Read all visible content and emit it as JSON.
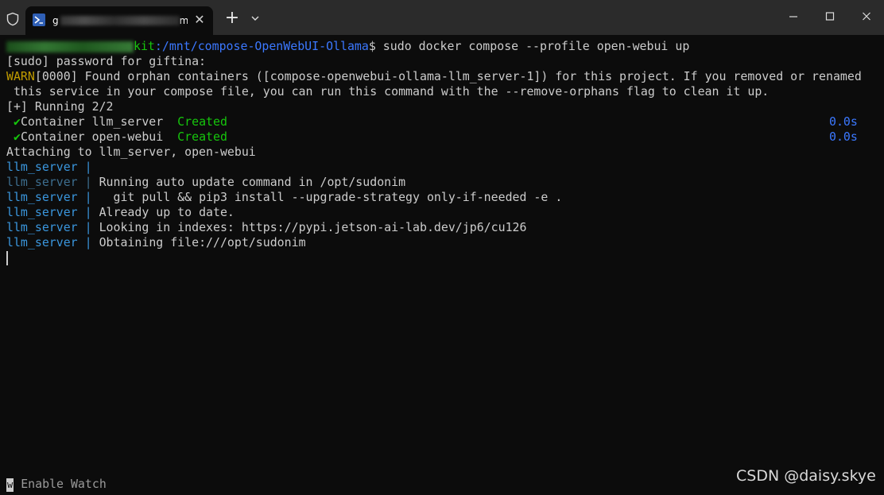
{
  "titlebar": {
    "tab_title": "g",
    "tab_title_tail": "m",
    "close_glyph": "✕",
    "new_tab_glyph": "+"
  },
  "prompt": {
    "user_visible_tail": "kit",
    "path": ":/mnt/compose-OpenWebUI-Ollama",
    "symbol": "$",
    "command": " sudo docker compose --profile open-webui up"
  },
  "lines": {
    "sudo": "[sudo] password for giftina:",
    "warn_label": "WARN",
    "warn_rest": "[0000] Found orphan containers ([compose-openwebui-ollama-llm_server-1]) for this project. If you removed or renamed",
    "warn_cont": " this service in your compose file, you can run this command with the --remove-orphans flag to clean it up.",
    "running": "[+] Running 2/2",
    "attaching": "Attaching to llm_server, open-webui"
  },
  "containers": [
    {
      "check": "✔",
      "name": "Container llm_server  ",
      "status": "Created",
      "duration": "0.0s"
    },
    {
      "check": "✔",
      "name": "Container open-webui  ",
      "status": "Created",
      "duration": "0.0s"
    }
  ],
  "logs": [
    {
      "service": "llm_server",
      "text": ""
    },
    {
      "service": "llm_server",
      "text": "Running auto update command in /opt/sudonim"
    },
    {
      "service": "llm_server",
      "text": "  git pull && pip3 install --upgrade-strategy only-if-needed -e ."
    },
    {
      "service": "llm_server",
      "text": "Already up to date."
    },
    {
      "service": "llm_server",
      "text": "Looking in indexes: https://pypi.jetson-ai-lab.dev/jp6/cu126"
    },
    {
      "service": "llm_server",
      "text": "Obtaining file:///opt/sudonim"
    }
  ],
  "log_separator": " | ",
  "footer": {
    "key": "w",
    "label": " Enable Watch"
  },
  "watermark": "CSDN @daisy.skye",
  "colors": {
    "background": "#0c0c0c",
    "titlebar": "#2b2b2b",
    "green": "#16c60c",
    "blue": "#3b78ff",
    "cyan": "#3a96dd",
    "yellow": "#c19c00",
    "text": "#cccccc"
  }
}
